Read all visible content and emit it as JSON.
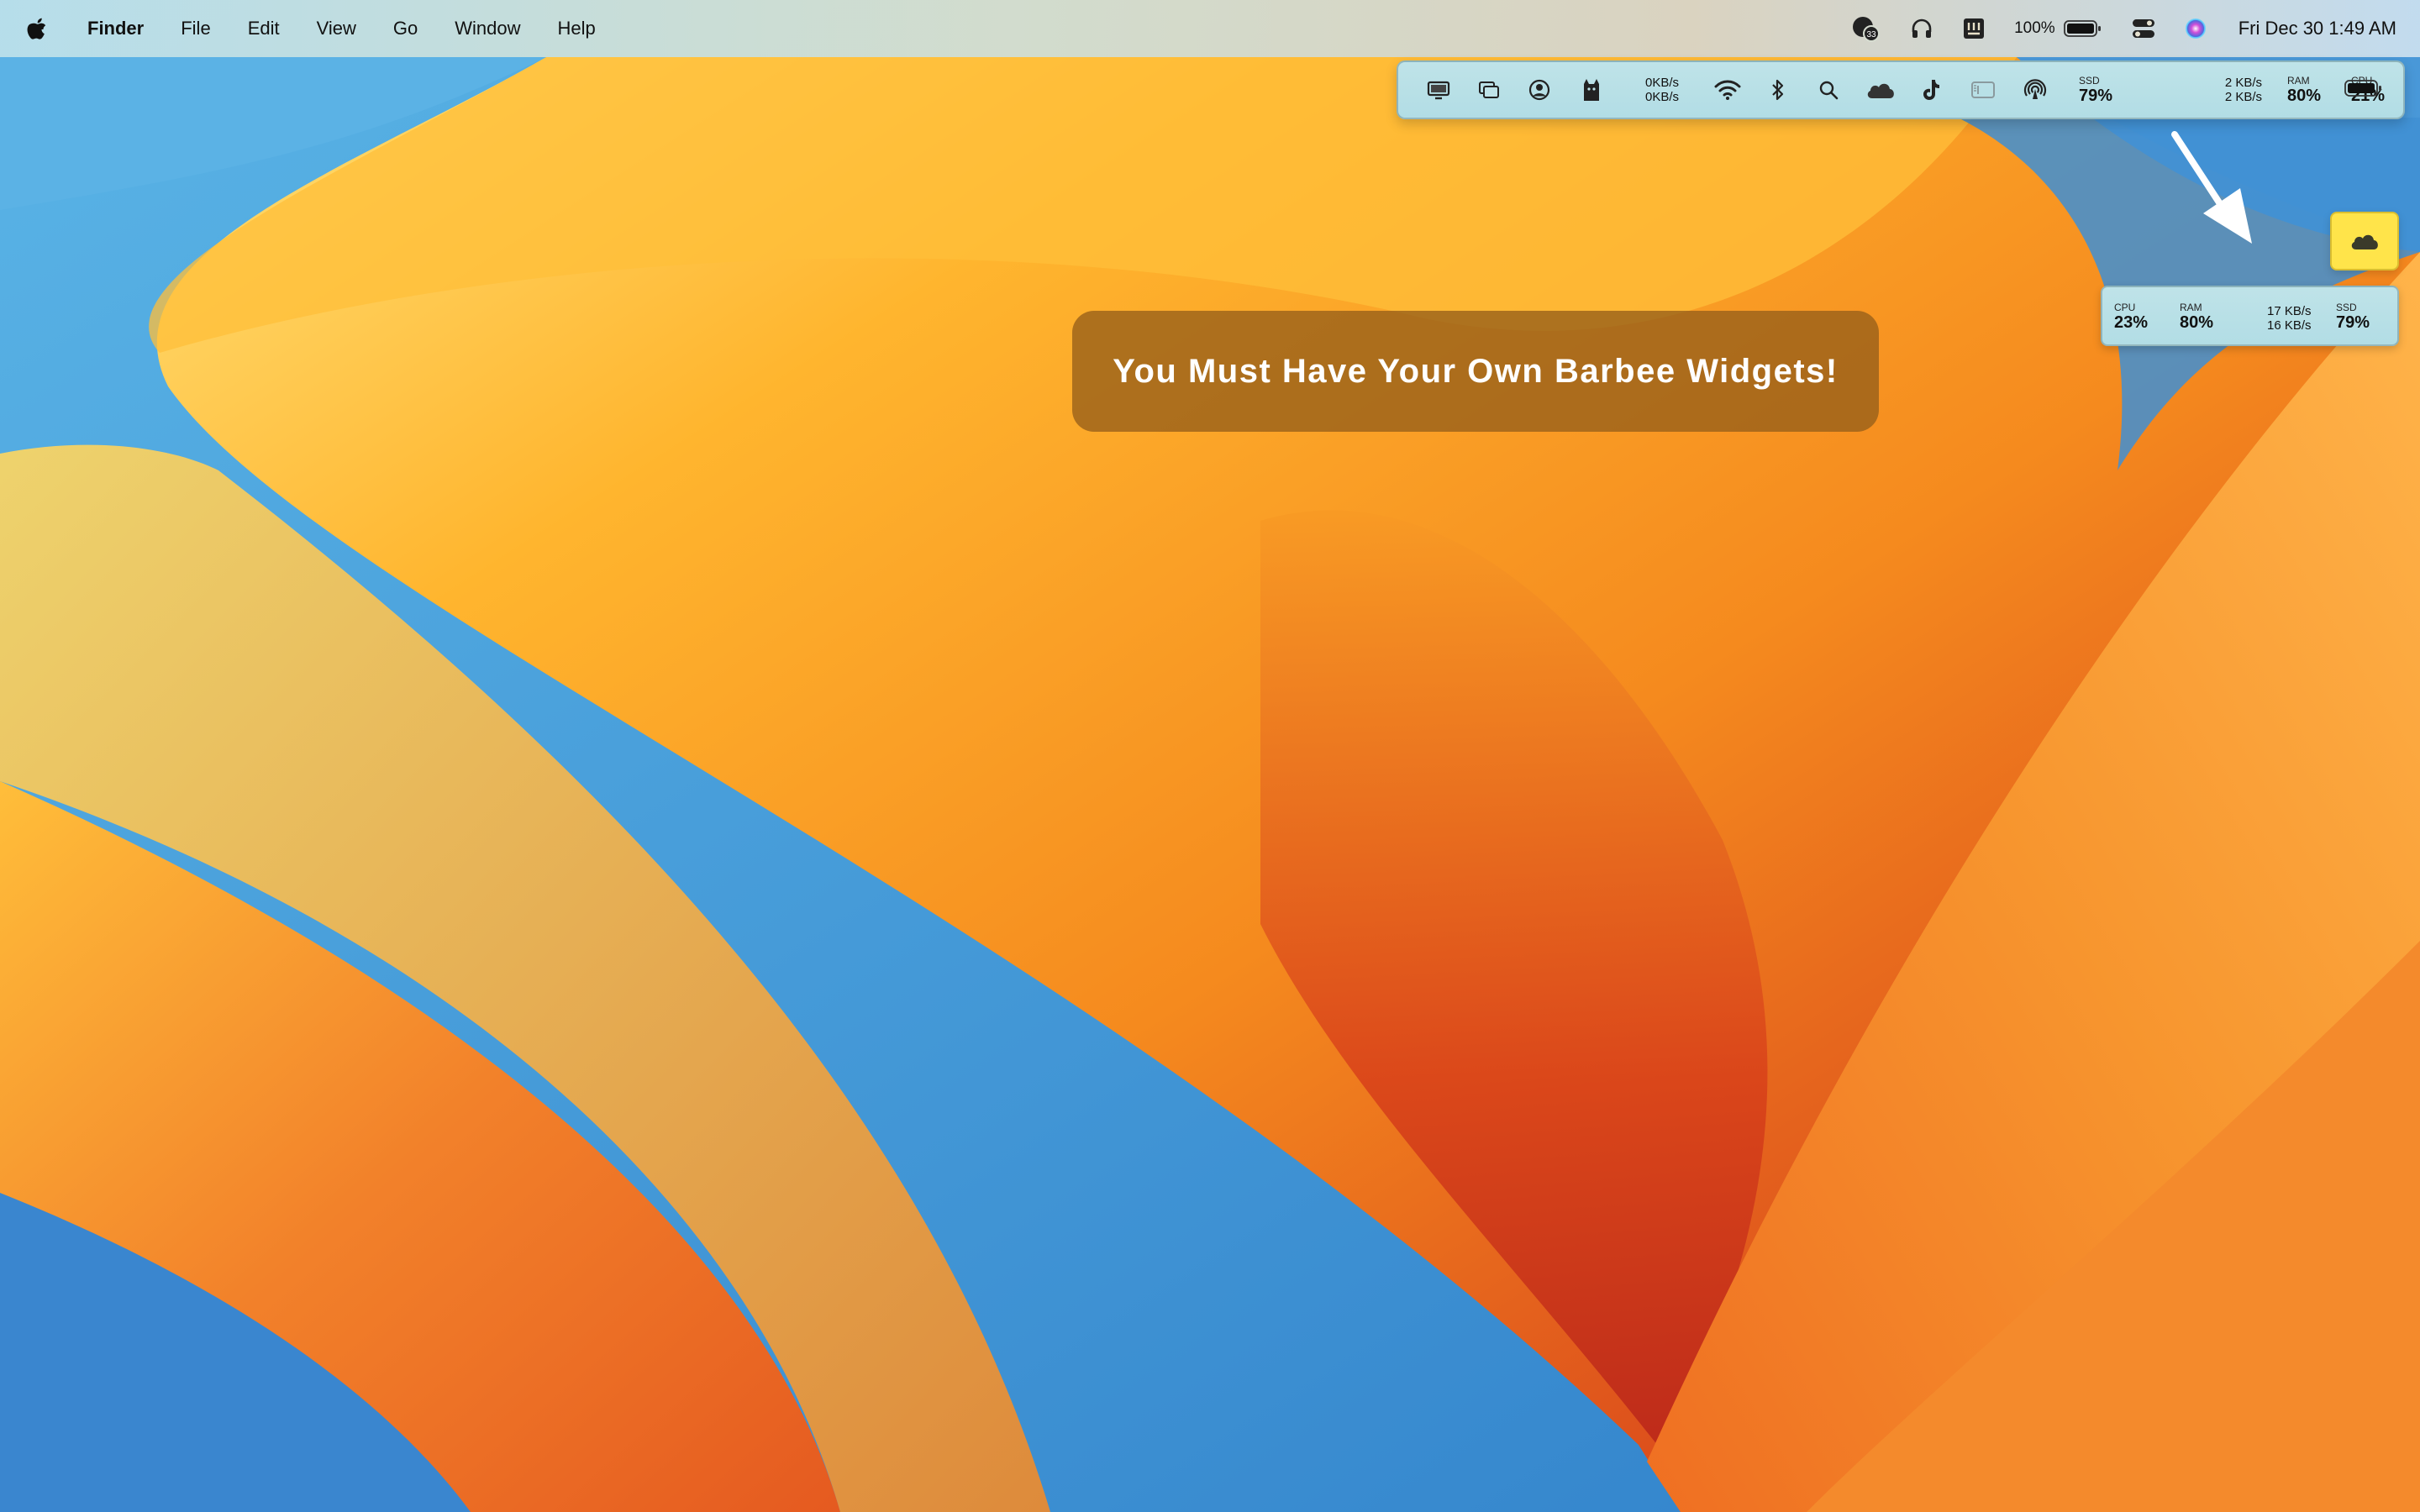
{
  "menubar": {
    "app_name": "Finder",
    "menus": [
      "File",
      "Edit",
      "View",
      "Go",
      "Window",
      "Help"
    ],
    "notification_badge": "33",
    "battery_percent": "100%",
    "clock": "Fri Dec 30  1:49 AM",
    "icons": [
      "apple-icon",
      "notification-center-icon",
      "headphones-icon",
      "text-app-icon",
      "battery-icon",
      "control-center-icon",
      "siri-icon"
    ]
  },
  "barbee": {
    "network_up": "0KB/s",
    "network_down": "0KB/s",
    "ssd_label": "SSD",
    "ssd_value": "79%",
    "net2_up": "2 KB/s",
    "net2_down": "2 KB/s",
    "ram_label": "RAM",
    "ram_value": "80%",
    "cpu_label": "CPU",
    "cpu_value": "21%",
    "icons": [
      "display-icon",
      "windows-icon",
      "user-circle-icon",
      "cat-icon",
      "wifi-icon",
      "bluetooth-icon",
      "search-icon",
      "cloud-icon",
      "tiktok-icon",
      "sidebar-icon",
      "airdrop-icon",
      "battery-icon"
    ]
  },
  "stats_widget": {
    "cpu_label": "CPU",
    "cpu_value": "23%",
    "ram_label": "RAM",
    "ram_value": "80%",
    "net_up": "17 KB/s",
    "net_down": "16 KB/s",
    "ssd_label": "SSD",
    "ssd_value": "79%"
  },
  "banner": {
    "text": "You Must Have Your Own Barbee Widgets!"
  },
  "colors": {
    "bar_bg": "#b8e0e6",
    "widget_yellow": "#ffe44a",
    "banner_bg": "#96601a"
  }
}
